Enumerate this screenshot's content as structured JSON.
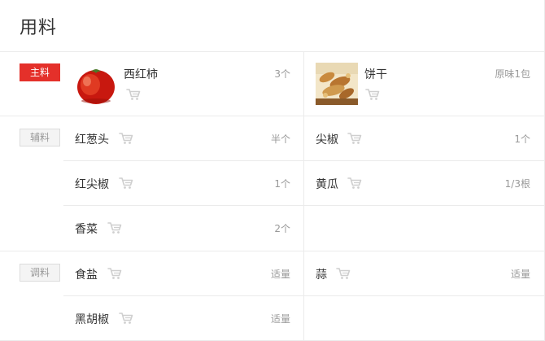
{
  "page": {
    "title": "用料"
  },
  "colors": {
    "accent_red": "#e4302a",
    "muted_text": "#999999",
    "divider": "#ebebeb",
    "cart_icon": "#cfcfcf"
  },
  "sections": [
    {
      "label": "主料",
      "items": [
        {
          "name": "西红柿",
          "qty": "3个",
          "image": "tomato"
        },
        {
          "name": "饼干",
          "qty": "原味1包",
          "image": "biscuit"
        }
      ]
    },
    {
      "label": "辅料",
      "items": [
        {
          "name": "红葱头",
          "qty": "半个"
        },
        {
          "name": "尖椒",
          "qty": "1个"
        },
        {
          "name": "红尖椒",
          "qty": "1个"
        },
        {
          "name": "黄瓜",
          "qty": "1/3根"
        },
        {
          "name": "香菜",
          "qty": "2个"
        }
      ]
    },
    {
      "label": "调料",
      "items": [
        {
          "name": "食盐",
          "qty": "适量"
        },
        {
          "name": "蒜",
          "qty": "适量"
        },
        {
          "name": "黑胡椒",
          "qty": "适量"
        }
      ]
    }
  ],
  "icons": {
    "cart": "shopping-cart-icon"
  }
}
